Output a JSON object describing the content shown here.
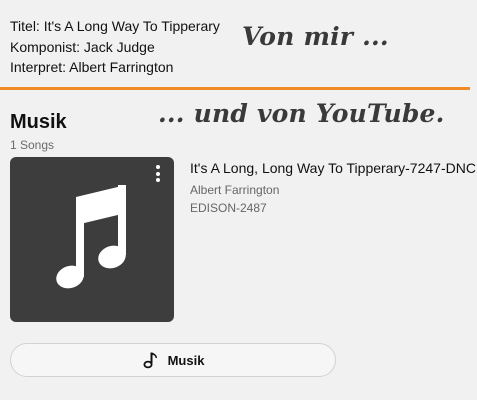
{
  "metadata": {
    "title_line": "Titel: It's A Long Way To Tipperary",
    "composer_line": "Komponist: Jack Judge",
    "performer_line": "Interpret: Albert Farrington"
  },
  "annotations": {
    "from_me": "Von mir ...",
    "from_youtube": "... und von YouTube."
  },
  "colors": {
    "divider": "#f08a24",
    "thumbnail_bg": "#3d3d3d"
  },
  "section": {
    "title": "Musik",
    "count": "1 Songs"
  },
  "song": {
    "title": "It's A Long, Long Way To Tipperary-7247-DNC",
    "artist": "Albert Farrington",
    "code": "EDISON-2487",
    "thumbnail_icon": "music-note-icon",
    "menu_icon": "more-vertical-icon"
  },
  "music_button": {
    "icon": "music-note-icon",
    "label": "Musik"
  }
}
